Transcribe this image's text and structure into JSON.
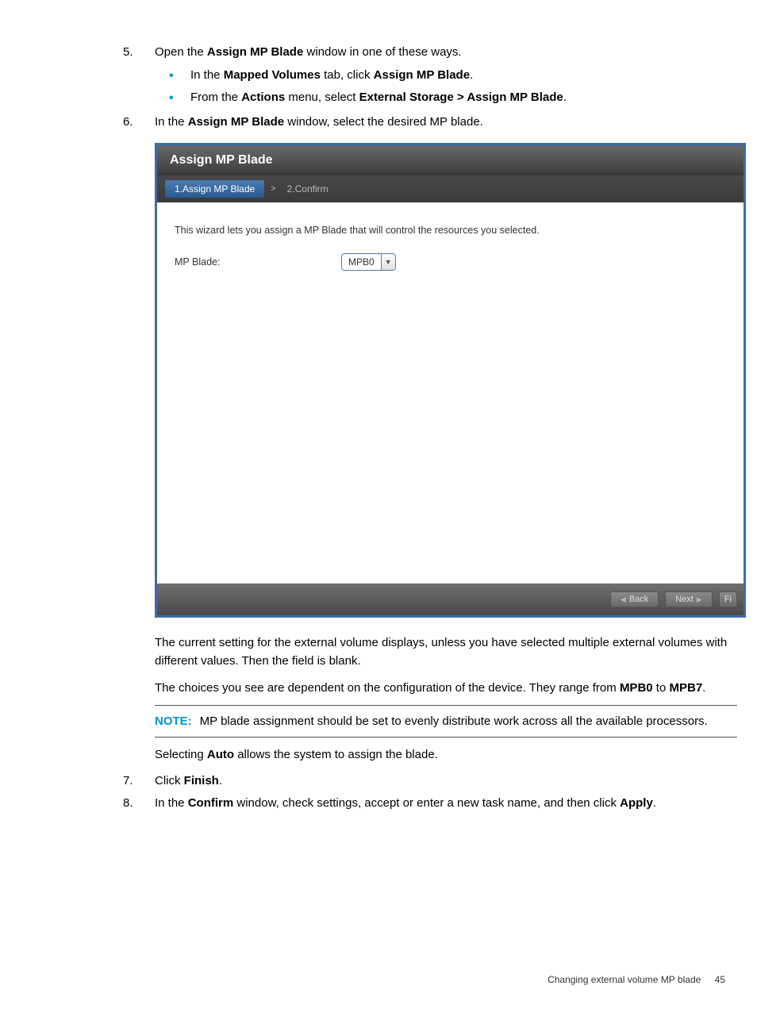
{
  "steps": {
    "s5": {
      "text_a": "Open the ",
      "bold_a": "Assign MP Blade",
      "text_b": " window in one of these ways.",
      "b1_a": "In the ",
      "b1_bold": "Mapped Volumes",
      "b1_b": " tab, click ",
      "b1_bold2": "Assign MP Blade",
      "b1_c": ".",
      "b2_a": "From the ",
      "b2_bold": "Actions",
      "b2_b": " menu, select  ",
      "b2_bold2": "External Storage > Assign MP Blade",
      "b2_c": "."
    },
    "s6": {
      "a": "In the ",
      "bold": "Assign MP Blade",
      "b": " window, select the desired MP blade."
    },
    "s7": {
      "a": "Click ",
      "bold": "Finish",
      "b": "."
    },
    "s8": {
      "a": "In the ",
      "bold": "Confirm",
      "b": " window, check settings, accept or enter a new task name, and then click ",
      "bold2": "Apply",
      "c": "."
    }
  },
  "wizard": {
    "title": "Assign MP Blade",
    "crumb1": "1.Assign MP Blade",
    "sep": ">",
    "crumb2": "2.Confirm",
    "intro": "This wizard lets you assign a MP Blade that will control the resources you selected.",
    "label": "MP Blade:",
    "select_value": "MPB0",
    "back": "Back",
    "next": "Next",
    "finish_partial": "Fi"
  },
  "post": {
    "p1": "The current setting for the external volume displays, unless you have selected multiple external volumes with different values. Then the field is blank.",
    "p2_a": "The choices you see are dependent on the configuration of the device. They range from ",
    "p2_bold1": "MPB0",
    "p2_b": " to ",
    "p2_bold2": "MPB7",
    "p2_c": ".",
    "note_label": "NOTE:",
    "note_text": "MP blade assignment should be set to evenly distribute work across all the available processors.",
    "p3_a": "Selecting ",
    "p3_bold": "Auto",
    "p3_b": " allows the system to assign the blade."
  },
  "footer": {
    "text": "Changing external volume MP blade",
    "page": "45"
  }
}
